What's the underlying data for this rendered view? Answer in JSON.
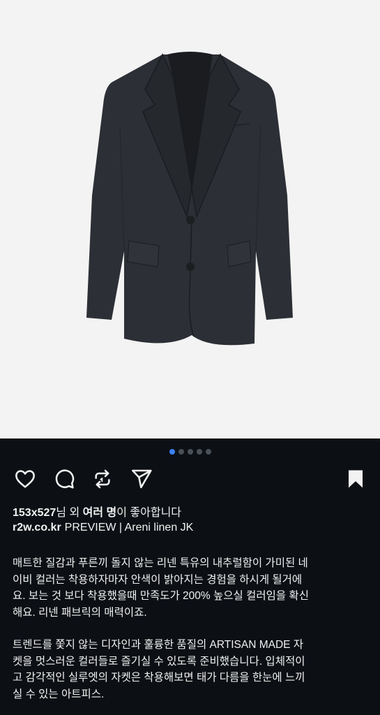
{
  "post": {
    "image": {
      "subject": "jacket-product-photo",
      "background_color": "#f3f3f3",
      "garment_color": "#2c2f35"
    },
    "carousel": {
      "total": 5,
      "active_index": 0,
      "active_color": "#3b82f6"
    },
    "actions": {
      "like_icon": "heart-icon",
      "comment_icon": "comment-icon",
      "repost_icon": "repost-icon",
      "share_icon": "send-icon",
      "save_icon": "bookmark-icon"
    },
    "likes": {
      "user": "153x527",
      "middle": "님 외 ",
      "others": "여러 명",
      "suffix": "이 좋아합니다"
    },
    "caption": {
      "username": "r2w.co.kr",
      "title": "PREVIEW | Areni linen JK"
    },
    "description": {
      "paragraph1": [
        "매트한 질감과 푸른끼 돌지 않는 리넨 특유의 내추럴함이 가미된 네",
        "이비 컬러는 착용하자마자 안색이 밝아지는 경험을 하시게 될거에",
        "요. 보는 것 보다 착용했을때 만족도가 200% 높으실 컬러임을 확신",
        "해요. 리넨 패브릭의 매력이죠."
      ],
      "paragraph2": [
        "트렌드를 쫓지 않는 디자인과 훌륭한 품질의 ARTISAN MADE 자",
        "켓을 멋스러운 컬러들로 즐기실 수 있도록 준비했습니다. 입체적이",
        "고 감각적인 실루엣의 자켓은 착용해보면 태가 다름을 한눈에 느끼",
        "실 수 있는 아트피스."
      ]
    }
  }
}
